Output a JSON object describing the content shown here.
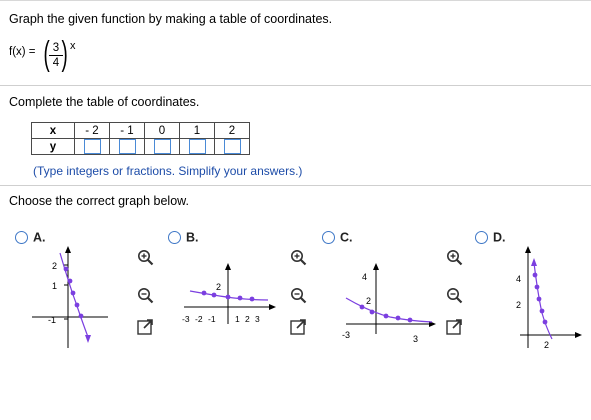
{
  "question": {
    "prompt": "Graph the given function by making a table of coordinates.",
    "function_name": "f(x) =",
    "base_numerator": "3",
    "base_denominator": "4",
    "exponent": "x"
  },
  "table": {
    "instruction": "Complete the table of coordinates.",
    "row_x_label": "x",
    "row_y_label": "y",
    "x_values": [
      "- 2",
      "- 1",
      "0",
      "1",
      "2"
    ],
    "y_values": [
      "",
      "",
      "",
      "",
      ""
    ],
    "hint": "(Type integers or fractions. Simplify your answers.)"
  },
  "choose": {
    "instruction": "Choose the correct graph below.",
    "options": [
      {
        "label": "A.",
        "tick_labels": [
          "2",
          "1",
          "-1"
        ]
      },
      {
        "label": "B.",
        "tick_labels": [
          "2",
          "-3",
          "-2",
          "-1",
          "1",
          "2",
          "3"
        ]
      },
      {
        "label": "C.",
        "tick_labels": [
          "4",
          "2",
          "-3",
          "3"
        ]
      },
      {
        "label": "D.",
        "tick_labels": [
          "4",
          "2",
          "2"
        ]
      }
    ]
  },
  "tools": {
    "zoom_in_icon": "magnifier-plus",
    "zoom_out_icon": "magnifier-minus",
    "popout_icon": "open-in-new-window"
  },
  "colors": {
    "accent": "#3f78c7",
    "curve": "#7b3fe0",
    "hint": "#1d4ca8"
  }
}
